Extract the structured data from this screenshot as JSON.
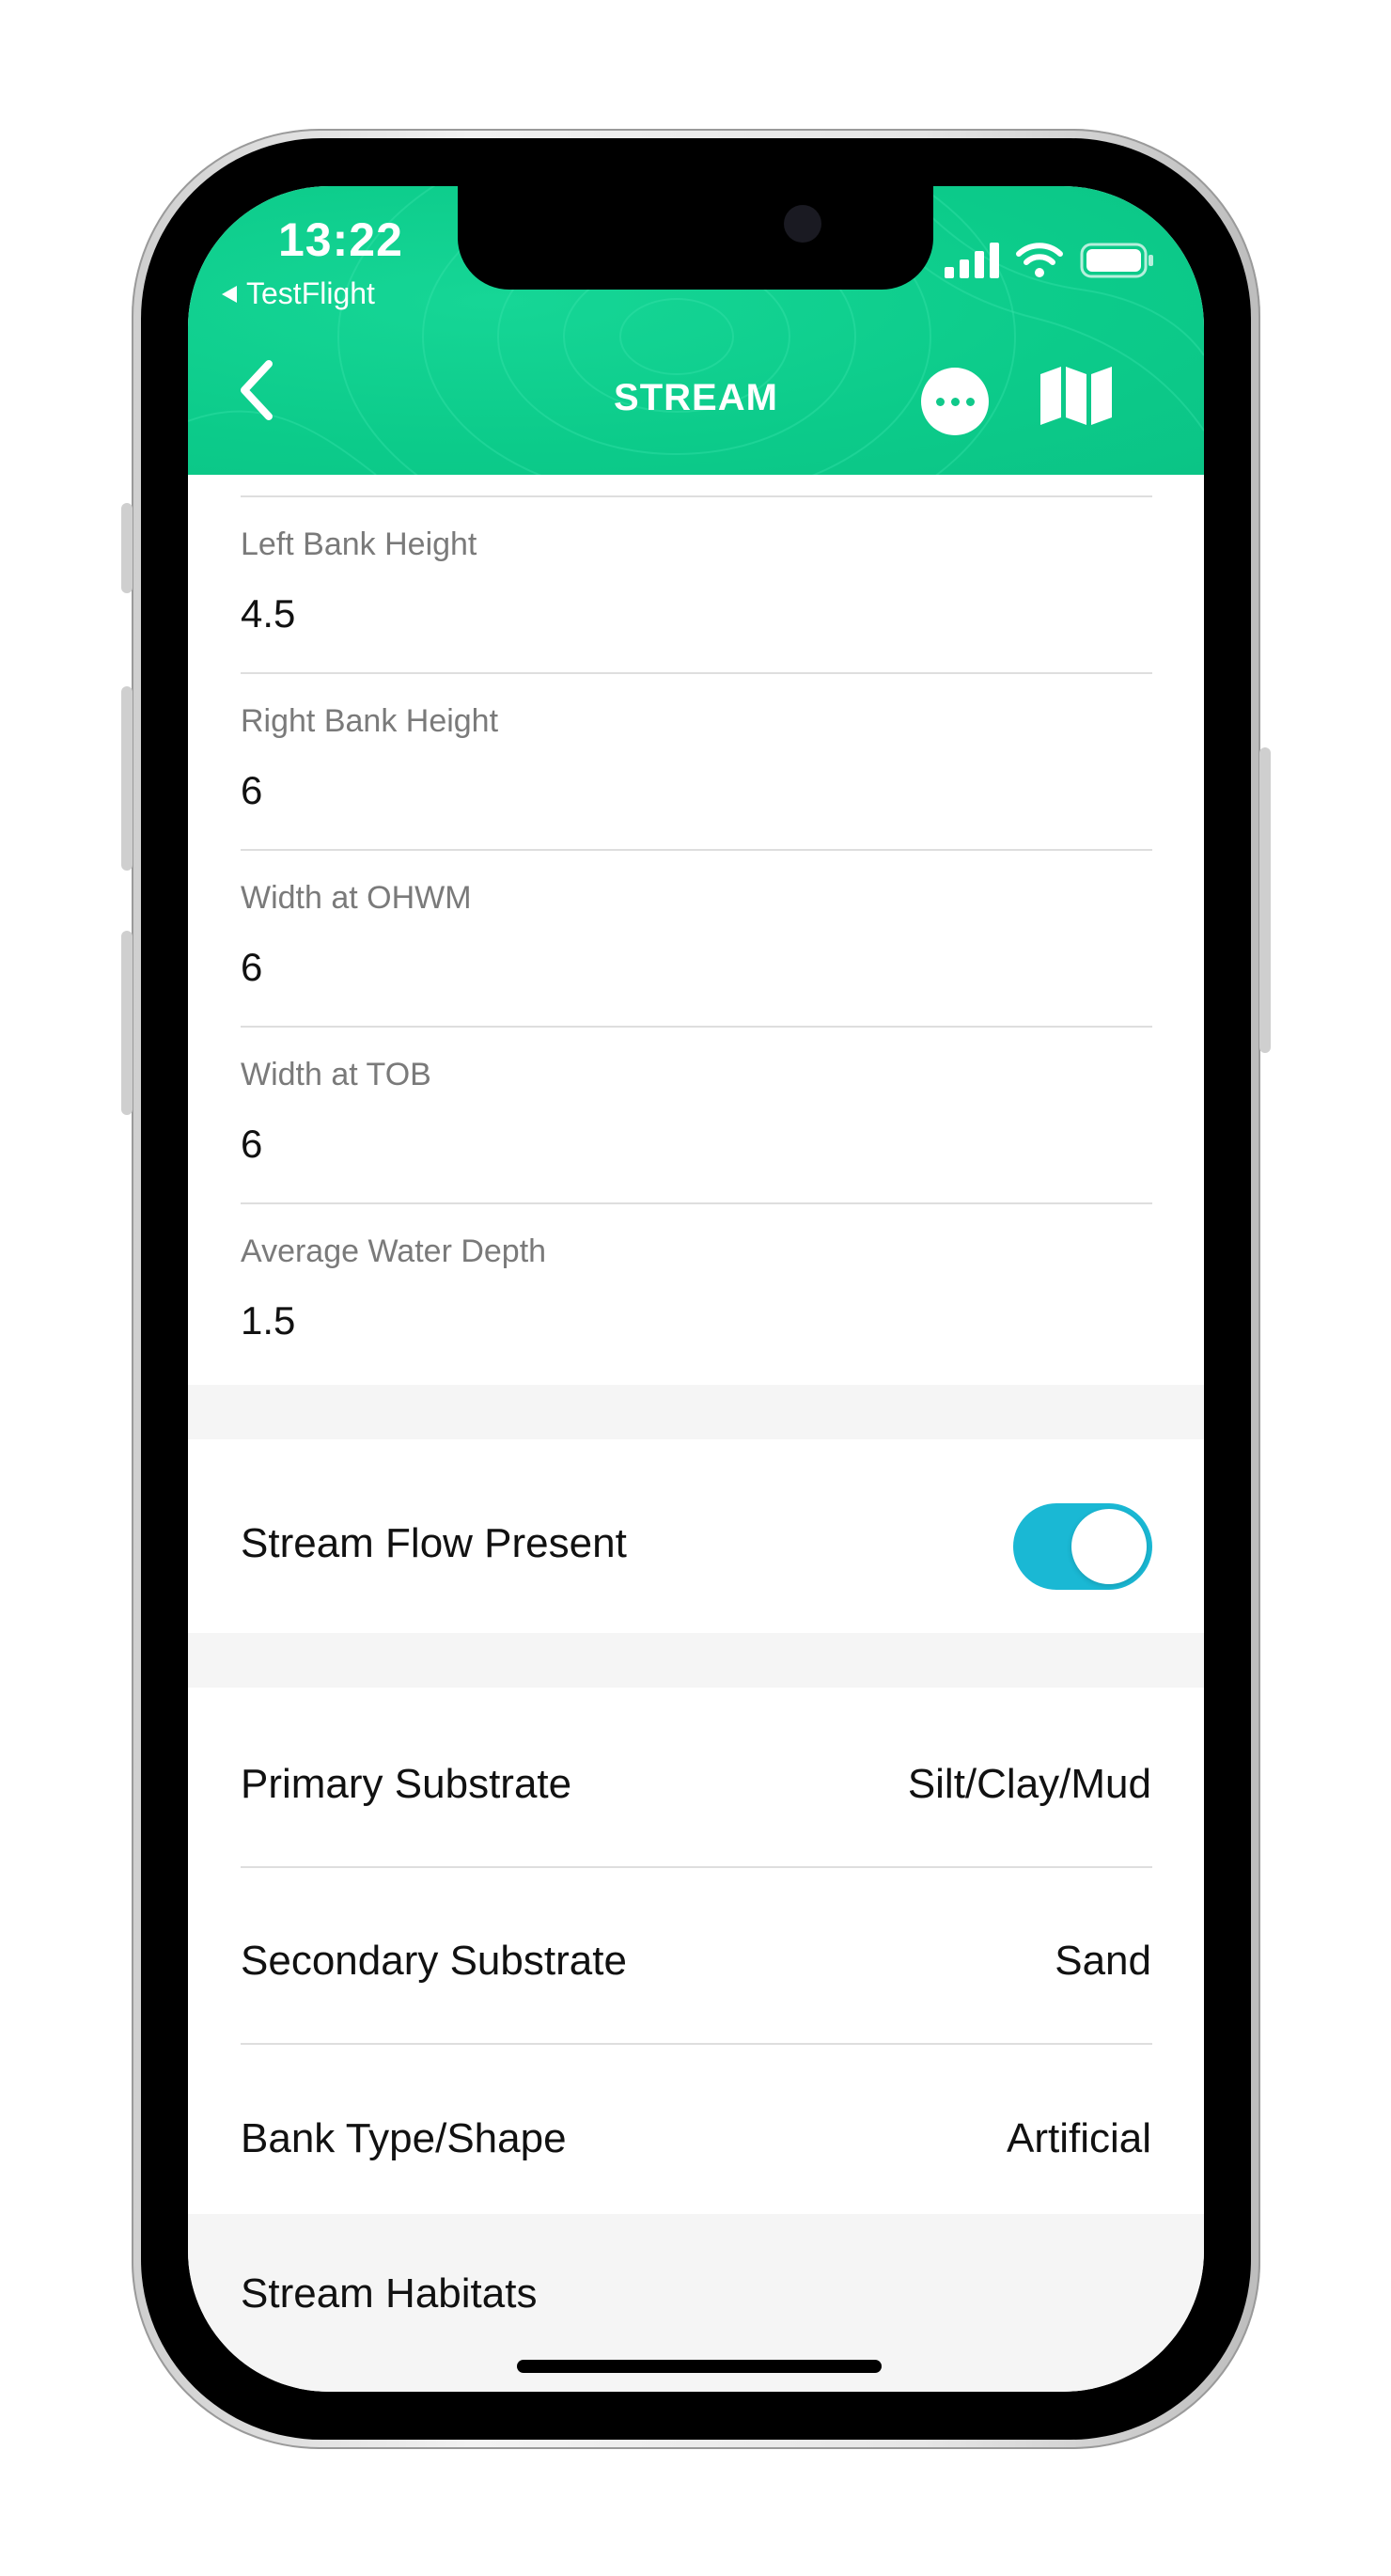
{
  "status_bar": {
    "time": "13:22",
    "back_app": "TestFlight"
  },
  "nav": {
    "title": "STREAM"
  },
  "measurements": [
    {
      "label": "Left Bank Height",
      "value": "4.5"
    },
    {
      "label": "Right Bank Height",
      "value": "6"
    },
    {
      "label": "Width at OHWM",
      "value": "6"
    },
    {
      "label": "Width at TOB",
      "value": "6"
    },
    {
      "label": "Average Water Depth",
      "value": "1.5"
    }
  ],
  "stream_flow": {
    "label": "Stream Flow Present",
    "enabled": true
  },
  "substrates": [
    {
      "label": "Primary Substrate",
      "value": "Silt/Clay/Mud"
    },
    {
      "label": "Secondary Substrate",
      "value": "Sand"
    },
    {
      "label": "Bank Type/Shape",
      "value": "Artificial"
    }
  ],
  "section_header": "Stream Habitats",
  "colors": {
    "header": "#0ccb8a",
    "toggle": "#1ab8d4",
    "band": "#f5f5f5"
  }
}
